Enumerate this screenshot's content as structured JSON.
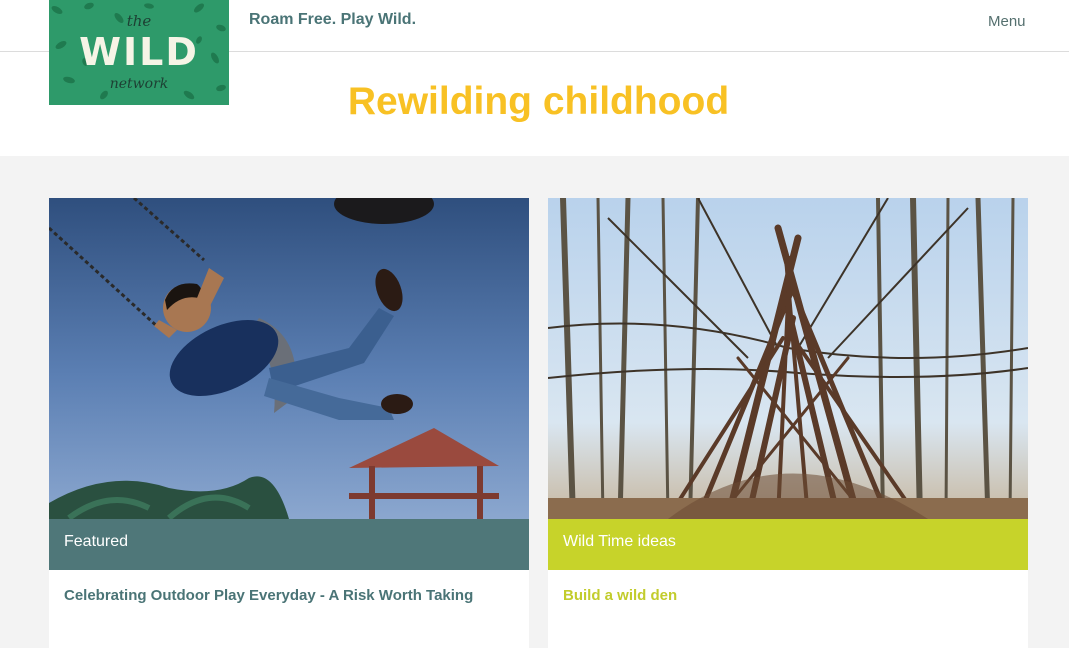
{
  "header": {
    "logo": {
      "line1": "the",
      "line2": "WILD",
      "line3": "network"
    },
    "tagline": "Roam Free. Play Wild.",
    "menu_label": "Menu"
  },
  "hero": {
    "title": "Rewilding childhood"
  },
  "cards": [
    {
      "image": "boy-on-swing-photo",
      "category": "Featured",
      "title": "Celebrating Outdoor Play Everyday - A Risk Worth Taking"
    },
    {
      "image": "stick-den-in-woods-photo",
      "category": "Wild Time ideas",
      "title": "Build a wild den"
    }
  ],
  "colors": {
    "title_yellow": "#f8c124",
    "featured_teal": "#4f7779",
    "wildtime_lime": "#c7d32a",
    "logo_green": "#2e9a6a",
    "page_bg": "#f3f3f3"
  }
}
